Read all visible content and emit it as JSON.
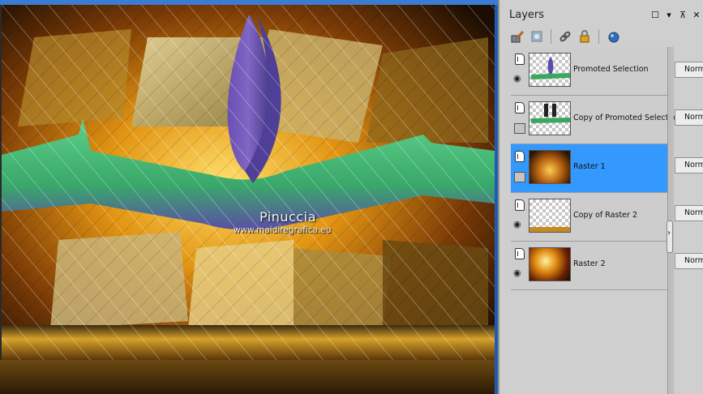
{
  "palette": {
    "title": "Layers",
    "window_buttons": [
      "restore-icon",
      "dropdown-icon",
      "pin-icon",
      "close-icon"
    ],
    "toolbar": [
      "brush-edit-icon",
      "mask-icon",
      "link-icon",
      "lock-icon",
      "new-layer-icon"
    ],
    "layers": [
      {
        "name": "Promoted Selection",
        "visible": true,
        "selected": false,
        "blend": "Normal"
      },
      {
        "name": "Copy of Promoted Selection",
        "visible": false,
        "selected": false,
        "blend": "Normal"
      },
      {
        "name": "Raster 1",
        "visible": false,
        "selected": true,
        "blend": "Normal"
      },
      {
        "name": "Copy of Raster 2",
        "visible": true,
        "selected": false,
        "blend": "Normal"
      },
      {
        "name": "Raster 2",
        "visible": true,
        "selected": false,
        "blend": "Normal"
      }
    ]
  },
  "canvas": {
    "watermark_title": "Pinuccia",
    "watermark_url": "www.maidiregrafica.eu"
  },
  "colors": {
    "selection": "#3399ff",
    "window_accent": "#1e5db3"
  }
}
